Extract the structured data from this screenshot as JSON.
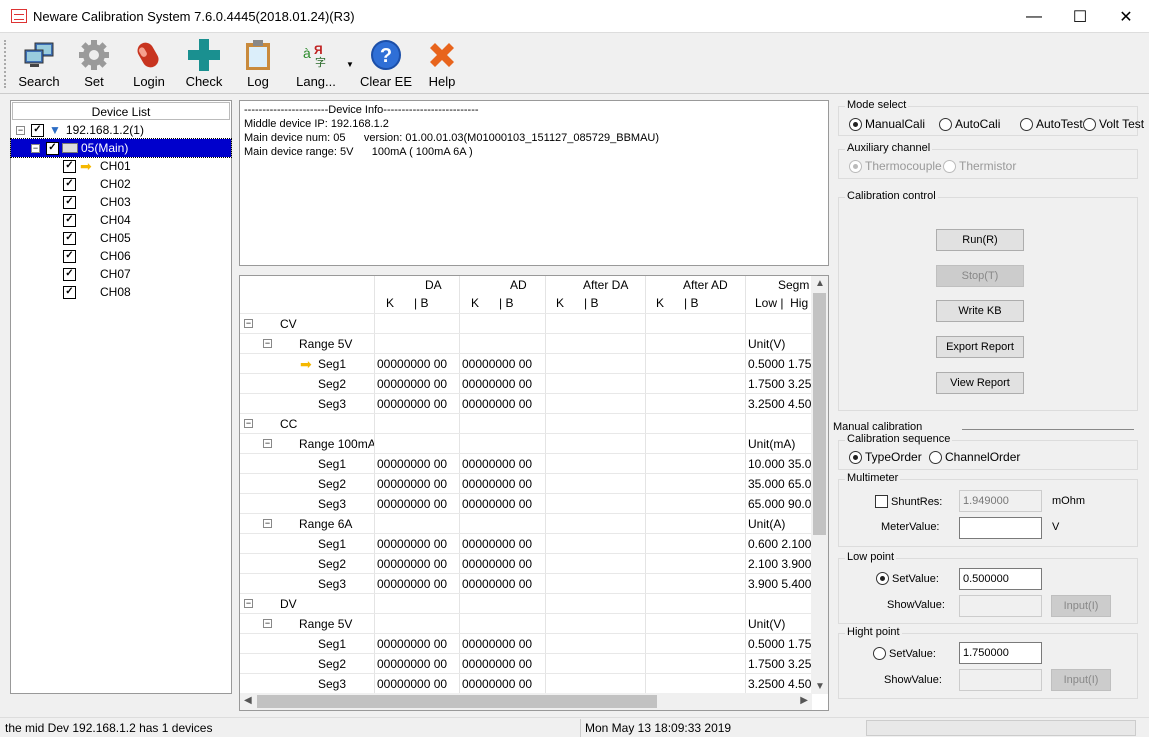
{
  "window": {
    "title": "Neware Calibration System 7.6.0.4445(2018.01.24)(R3)",
    "icon": "neware-app-icon",
    "controls": {
      "minimize": "—",
      "maximize": "☐",
      "close": "✕"
    }
  },
  "toolbar": {
    "items": [
      {
        "label": "Search",
        "icon": "network-computers-icon"
      },
      {
        "label": "Set",
        "icon": "gear-icon"
      },
      {
        "label": "Login",
        "icon": "login-capsule-icon"
      },
      {
        "label": "Check",
        "icon": "cross-plus-icon"
      },
      {
        "label": "Log",
        "icon": "clipboard-icon"
      },
      {
        "label": "Lang...",
        "icon": "language-icon"
      },
      {
        "label": "Clear EE",
        "icon": "help-question-icon"
      },
      {
        "label": "Help",
        "icon": "close-x-icon"
      }
    ]
  },
  "device_list": {
    "header": "Device List",
    "root": {
      "label": "192.168.1.2(1)",
      "checked": true
    },
    "device": {
      "label": "05(Main)",
      "checked": true,
      "selected": true
    },
    "channels": [
      {
        "label": "CH01",
        "checked": true,
        "current": true
      },
      {
        "label": "CH02",
        "checked": true
      },
      {
        "label": "CH03",
        "checked": true
      },
      {
        "label": "CH04",
        "checked": true
      },
      {
        "label": "CH05",
        "checked": true
      },
      {
        "label": "CH06",
        "checked": true
      },
      {
        "label": "CH07",
        "checked": true
      },
      {
        "label": "CH08",
        "checked": true
      }
    ]
  },
  "device_info": {
    "lines": [
      "-----------------------Device Info--------------------------",
      "Middle device IP: 192.168.1.2",
      "Main device num: 05      version: 01.00.01.03(M01000103_151127_085729_BBMAU)",
      "Main device range: 5V      100mA ( 100mA 6A )"
    ]
  },
  "grid": {
    "headers": {
      "da": "DA",
      "ad": "AD",
      "after_da": "After DA",
      "after_ad": "After AD",
      "segment": "Segm",
      "k": "K",
      "b": "| B",
      "low_high": "Low |  Hig"
    },
    "rows": [
      {
        "level": 0,
        "name": "CV",
        "da": "",
        "ad": "",
        "seg": ""
      },
      {
        "level": 1,
        "name": "Range 5V",
        "da": "",
        "ad": "",
        "seg": "Unit(V)"
      },
      {
        "level": 2,
        "name": "Seg1",
        "da": "00000000 00",
        "ad": "00000000 00",
        "seg": "0.5000 1.75",
        "current": true
      },
      {
        "level": 2,
        "name": "Seg2",
        "da": "00000000 00",
        "ad": "00000000 00",
        "seg": "1.7500 3.25"
      },
      {
        "level": 2,
        "name": "Seg3",
        "da": "00000000 00",
        "ad": "00000000 00",
        "seg": "3.2500 4.50"
      },
      {
        "level": 0,
        "name": "CC",
        "da": "",
        "ad": "",
        "seg": ""
      },
      {
        "level": 1,
        "name": "Range 100mA",
        "da": "",
        "ad": "",
        "seg": "Unit(mA)"
      },
      {
        "level": 2,
        "name": "Seg1",
        "da": "00000000 00",
        "ad": "00000000 00",
        "seg": "10.000 35.0"
      },
      {
        "level": 2,
        "name": "Seg2",
        "da": "00000000 00",
        "ad": "00000000 00",
        "seg": "35.000 65.0"
      },
      {
        "level": 2,
        "name": "Seg3",
        "da": "00000000 00",
        "ad": "00000000 00",
        "seg": "65.000 90.0"
      },
      {
        "level": 1,
        "name": "Range 6A",
        "da": "",
        "ad": "",
        "seg": "Unit(A)"
      },
      {
        "level": 2,
        "name": "Seg1",
        "da": "00000000 00",
        "ad": "00000000 00",
        "seg": "0.600 2.100"
      },
      {
        "level": 2,
        "name": "Seg2",
        "da": "00000000 00",
        "ad": "00000000 00",
        "seg": "2.100 3.900"
      },
      {
        "level": 2,
        "name": "Seg3",
        "da": "00000000 00",
        "ad": "00000000 00",
        "seg": "3.900 5.400"
      },
      {
        "level": 0,
        "name": "DV",
        "da": "",
        "ad": "",
        "seg": ""
      },
      {
        "level": 1,
        "name": "Range 5V",
        "da": "",
        "ad": "",
        "seg": "Unit(V)"
      },
      {
        "level": 2,
        "name": "Seg1",
        "da": "00000000 00",
        "ad": "00000000 00",
        "seg": "0.5000 1.75"
      },
      {
        "level": 2,
        "name": "Seg2",
        "da": "00000000 00",
        "ad": "00000000 00",
        "seg": "1.7500 3.25"
      },
      {
        "level": 2,
        "name": "Seg3",
        "da": "00000000 00",
        "ad": "00000000 00",
        "seg": "3.2500 4.50"
      }
    ]
  },
  "right_panel": {
    "mode_select": {
      "legend": "Mode select",
      "options": [
        {
          "label": "ManualCali",
          "selected": true
        },
        {
          "label": "AutoCali",
          "selected": false
        },
        {
          "label": "AutoTest",
          "selected": false
        },
        {
          "label": "Volt Test",
          "selected": false
        }
      ]
    },
    "auxiliary": {
      "legend": "Auxiliary channel",
      "options": [
        {
          "label": "Thermocouple",
          "selected": true,
          "disabled": true
        },
        {
          "label": "Thermistor",
          "selected": false,
          "disabled": true
        }
      ]
    },
    "calibration_control": {
      "legend": "Calibration control",
      "buttons": [
        {
          "label": "Run(R)",
          "disabled": false
        },
        {
          "label": "Stop(T)",
          "disabled": true
        },
        {
          "label": "Write KB",
          "disabled": false
        },
        {
          "label": "Export Report",
          "disabled": false
        },
        {
          "label": "View Report",
          "disabled": false
        }
      ]
    },
    "manual_calibration": {
      "title": "Manual calibration",
      "sequence": {
        "legend": "Calibration sequence",
        "options": [
          {
            "label": "TypeOrder",
            "selected": true
          },
          {
            "label": "ChannelOrder",
            "selected": false
          }
        ]
      },
      "multimeter": {
        "legend": "Multimeter",
        "shunt_label": "ShuntRes:",
        "shunt_checked": false,
        "shunt_value": "1.949000",
        "shunt_unit": "mOhm",
        "meter_label": "MeterValue:",
        "meter_value": "",
        "meter_unit": "V"
      },
      "low_point": {
        "legend": "Low point",
        "set_label": "SetValue:",
        "set_selected": true,
        "set_value": "0.500000",
        "show_label": "ShowValue:",
        "show_value": "",
        "input_button": "Input(I)"
      },
      "high_point": {
        "legend": "Hight point",
        "set_label": "SetValue:",
        "set_selected": false,
        "set_value": "1.750000",
        "show_label": "ShowValue:",
        "show_value": "",
        "input_button": "Input(I)"
      }
    }
  },
  "statusbar": {
    "message": "the mid Dev 192.168.1.2 has 1 devices",
    "datetime": "Mon May 13 18:09:33 2019"
  },
  "colors": {
    "selection": "#0000cc",
    "arrow": "#f5b800",
    "check_cross": "#1a9090",
    "help_blue": "#2f6fd6",
    "close_orange": "#e8641c"
  }
}
